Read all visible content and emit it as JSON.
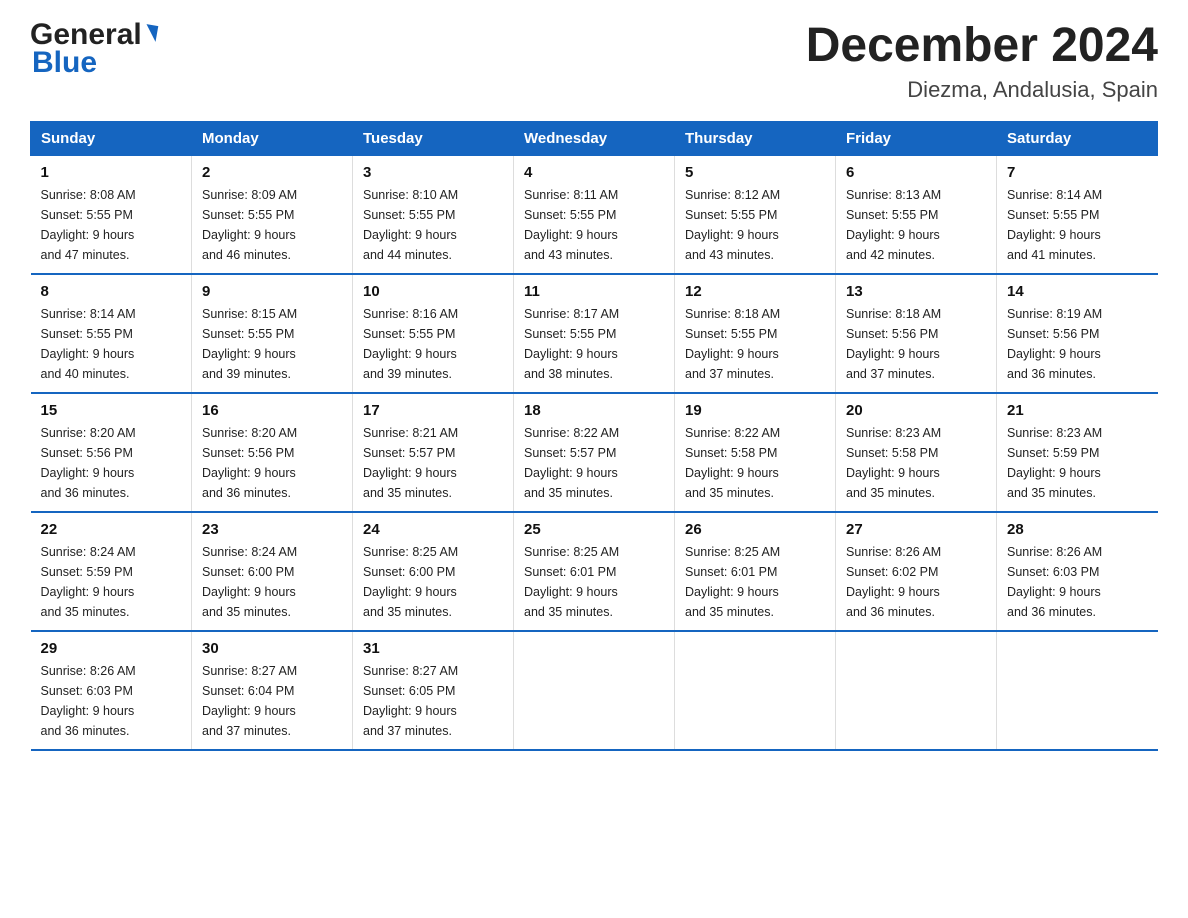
{
  "header": {
    "logo_general": "General",
    "logo_blue": "Blue",
    "title": "December 2024",
    "subtitle": "Diezma, Andalusia, Spain"
  },
  "days_of_week": [
    "Sunday",
    "Monday",
    "Tuesday",
    "Wednesday",
    "Thursday",
    "Friday",
    "Saturday"
  ],
  "weeks": [
    [
      {
        "day": "1",
        "sunrise": "8:08 AM",
        "sunset": "5:55 PM",
        "daylight": "9 hours and 47 minutes."
      },
      {
        "day": "2",
        "sunrise": "8:09 AM",
        "sunset": "5:55 PM",
        "daylight": "9 hours and 46 minutes."
      },
      {
        "day": "3",
        "sunrise": "8:10 AM",
        "sunset": "5:55 PM",
        "daylight": "9 hours and 44 minutes."
      },
      {
        "day": "4",
        "sunrise": "8:11 AM",
        "sunset": "5:55 PM",
        "daylight": "9 hours and 43 minutes."
      },
      {
        "day": "5",
        "sunrise": "8:12 AM",
        "sunset": "5:55 PM",
        "daylight": "9 hours and 43 minutes."
      },
      {
        "day": "6",
        "sunrise": "8:13 AM",
        "sunset": "5:55 PM",
        "daylight": "9 hours and 42 minutes."
      },
      {
        "day": "7",
        "sunrise": "8:14 AM",
        "sunset": "5:55 PM",
        "daylight": "9 hours and 41 minutes."
      }
    ],
    [
      {
        "day": "8",
        "sunrise": "8:14 AM",
        "sunset": "5:55 PM",
        "daylight": "9 hours and 40 minutes."
      },
      {
        "day": "9",
        "sunrise": "8:15 AM",
        "sunset": "5:55 PM",
        "daylight": "9 hours and 39 minutes."
      },
      {
        "day": "10",
        "sunrise": "8:16 AM",
        "sunset": "5:55 PM",
        "daylight": "9 hours and 39 minutes."
      },
      {
        "day": "11",
        "sunrise": "8:17 AM",
        "sunset": "5:55 PM",
        "daylight": "9 hours and 38 minutes."
      },
      {
        "day": "12",
        "sunrise": "8:18 AM",
        "sunset": "5:55 PM",
        "daylight": "9 hours and 37 minutes."
      },
      {
        "day": "13",
        "sunrise": "8:18 AM",
        "sunset": "5:56 PM",
        "daylight": "9 hours and 37 minutes."
      },
      {
        "day": "14",
        "sunrise": "8:19 AM",
        "sunset": "5:56 PM",
        "daylight": "9 hours and 36 minutes."
      }
    ],
    [
      {
        "day": "15",
        "sunrise": "8:20 AM",
        "sunset": "5:56 PM",
        "daylight": "9 hours and 36 minutes."
      },
      {
        "day": "16",
        "sunrise": "8:20 AM",
        "sunset": "5:56 PM",
        "daylight": "9 hours and 36 minutes."
      },
      {
        "day": "17",
        "sunrise": "8:21 AM",
        "sunset": "5:57 PM",
        "daylight": "9 hours and 35 minutes."
      },
      {
        "day": "18",
        "sunrise": "8:22 AM",
        "sunset": "5:57 PM",
        "daylight": "9 hours and 35 minutes."
      },
      {
        "day": "19",
        "sunrise": "8:22 AM",
        "sunset": "5:58 PM",
        "daylight": "9 hours and 35 minutes."
      },
      {
        "day": "20",
        "sunrise": "8:23 AM",
        "sunset": "5:58 PM",
        "daylight": "9 hours and 35 minutes."
      },
      {
        "day": "21",
        "sunrise": "8:23 AM",
        "sunset": "5:59 PM",
        "daylight": "9 hours and 35 minutes."
      }
    ],
    [
      {
        "day": "22",
        "sunrise": "8:24 AM",
        "sunset": "5:59 PM",
        "daylight": "9 hours and 35 minutes."
      },
      {
        "day": "23",
        "sunrise": "8:24 AM",
        "sunset": "6:00 PM",
        "daylight": "9 hours and 35 minutes."
      },
      {
        "day": "24",
        "sunrise": "8:25 AM",
        "sunset": "6:00 PM",
        "daylight": "9 hours and 35 minutes."
      },
      {
        "day": "25",
        "sunrise": "8:25 AM",
        "sunset": "6:01 PM",
        "daylight": "9 hours and 35 minutes."
      },
      {
        "day": "26",
        "sunrise": "8:25 AM",
        "sunset": "6:01 PM",
        "daylight": "9 hours and 35 minutes."
      },
      {
        "day": "27",
        "sunrise": "8:26 AM",
        "sunset": "6:02 PM",
        "daylight": "9 hours and 36 minutes."
      },
      {
        "day": "28",
        "sunrise": "8:26 AM",
        "sunset": "6:03 PM",
        "daylight": "9 hours and 36 minutes."
      }
    ],
    [
      {
        "day": "29",
        "sunrise": "8:26 AM",
        "sunset": "6:03 PM",
        "daylight": "9 hours and 36 minutes."
      },
      {
        "day": "30",
        "sunrise": "8:27 AM",
        "sunset": "6:04 PM",
        "daylight": "9 hours and 37 minutes."
      },
      {
        "day": "31",
        "sunrise": "8:27 AM",
        "sunset": "6:05 PM",
        "daylight": "9 hours and 37 minutes."
      },
      null,
      null,
      null,
      null
    ]
  ],
  "labels": {
    "sunrise": "Sunrise:",
    "sunset": "Sunset:",
    "daylight": "Daylight:"
  }
}
